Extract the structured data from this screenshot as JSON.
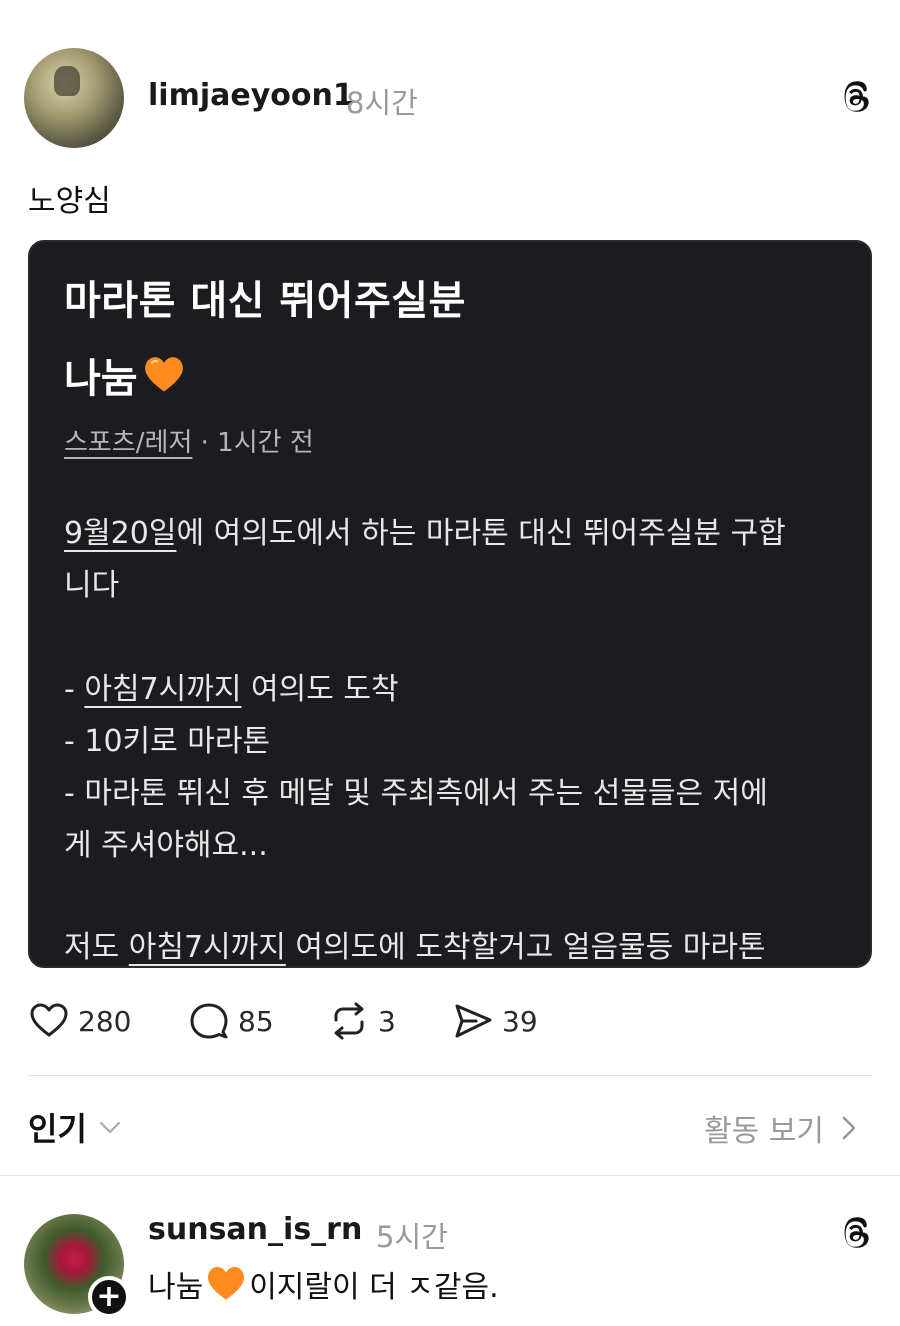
{
  "post": {
    "username": "limjaeyoon1",
    "time": "8시간",
    "text": "노양심",
    "card": {
      "title_line1": "마라톤 대신 뛰어주실분",
      "title_line2": "나눔",
      "category": "스포츠/레저",
      "posted": " · 1시간 전",
      "lines": [
        {
          "pre": "",
          "u": "9월20일",
          "post": "에 여의도에서 하는 마라톤 대신 뛰어주실분 구합"
        },
        {
          "pre": "니다",
          "u": "",
          "post": ""
        },
        {
          "pre": "- ",
          "u": "아침7시까지",
          "post": " 여의도 도착"
        },
        {
          "pre": "- 10키로 마라톤",
          "u": "",
          "post": ""
        },
        {
          "pre": "- 마라톤 뛰신 후 메달 및 주최측에서 주는 선물들은 저에",
          "u": "",
          "post": ""
        },
        {
          "pre": "게 주셔야해요...",
          "u": "",
          "post": ""
        },
        {
          "pre": "저도 ",
          "u": "아침7시까지",
          "post": " 여의도에 도착할거고 얼음물등 마라톤"
        }
      ]
    },
    "actions": {
      "likes": "280",
      "comments": "85",
      "reposts": "3",
      "shares": "39"
    }
  },
  "sort": {
    "label": "인기",
    "activity_label": "활동 보기"
  },
  "reply": {
    "username": "sunsan_is_rn",
    "time": "5시간",
    "text_before": "나눔",
    "text_after": " 이지랄이 더 ㅈ같음."
  },
  "icons": {
    "post_menu": "threads-logo-icon",
    "heart_emoji": "orange-heart-emoji",
    "like": "heart-outline-icon",
    "comment": "comment-bubble-icon",
    "repost": "repost-icon",
    "share": "send-icon",
    "sort": "chevron-down-icon",
    "activity": "chevron-right-icon"
  },
  "colors": {
    "card_bg": "#1c1c20",
    "heart_emoji": "#ff8a1f",
    "muted": "#9a9a9a"
  }
}
